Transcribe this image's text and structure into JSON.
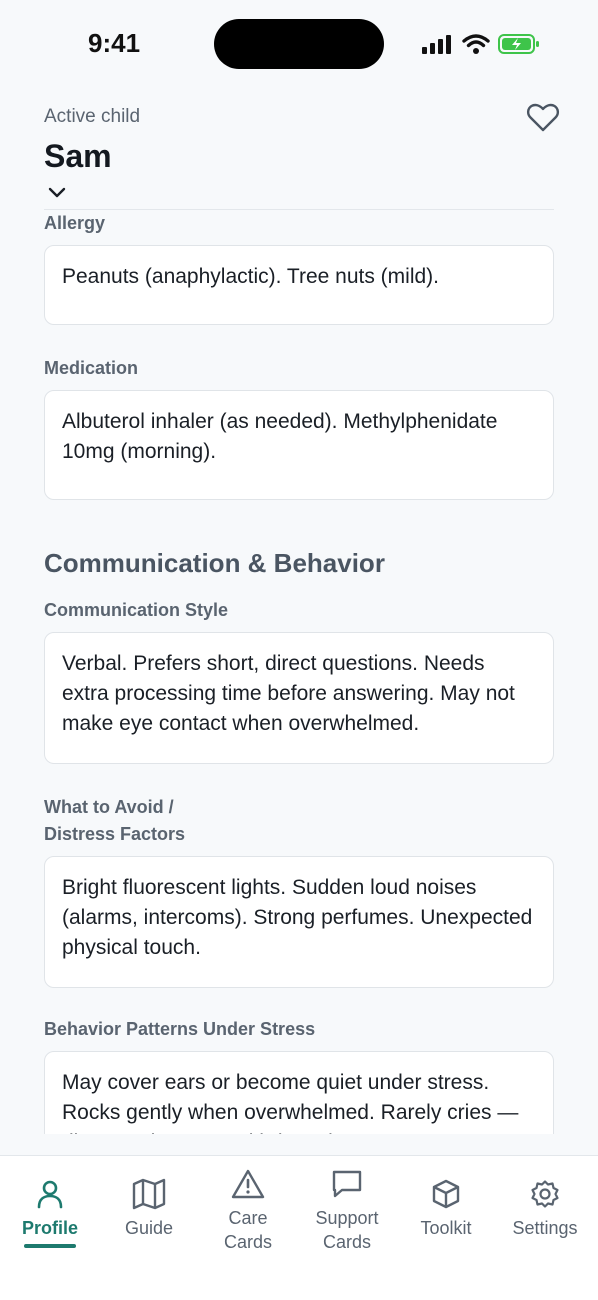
{
  "status": {
    "time": "9:41"
  },
  "header": {
    "active_label": "Active child",
    "child_name": "Sam"
  },
  "fields": {
    "allergy": {
      "label": "Allergy",
      "value": "Peanuts (anaphylactic). Tree nuts (mild)."
    },
    "medication": {
      "label": "Medication",
      "value": "Albuterol inhaler (as needed). Methylphenidate 10mg (morning)."
    }
  },
  "section": {
    "title": "Communication & Behavior"
  },
  "comm": {
    "style": {
      "label": "Communication Style",
      "value": "Verbal. Prefers short, direct questions. Needs extra processing time before answering. May not make eye contact when overwhelmed."
    },
    "avoid": {
      "label_line1": "What to Avoid /",
      "label_line2": "Distress Factors",
      "value": "Bright fluorescent lights. Sudden loud noises (alarms, intercoms). Strong perfumes. Unexpected physical touch."
    },
    "stress": {
      "label": "Behavior Patterns Under Stress",
      "value": "May cover ears or become quiet under stress. Rocks gently when overwhelmed. Rarely cries — distress shows as withdrawal."
    }
  },
  "tabs": {
    "profile": "Profile",
    "guide": "Guide",
    "care_1": "Care",
    "care_2": "Cards",
    "support_1": "Support",
    "support_2": "Cards",
    "toolkit": "Toolkit",
    "settings": "Settings"
  },
  "colors": {
    "accent": "#1d7a6e",
    "battery": "#3ec44a"
  }
}
